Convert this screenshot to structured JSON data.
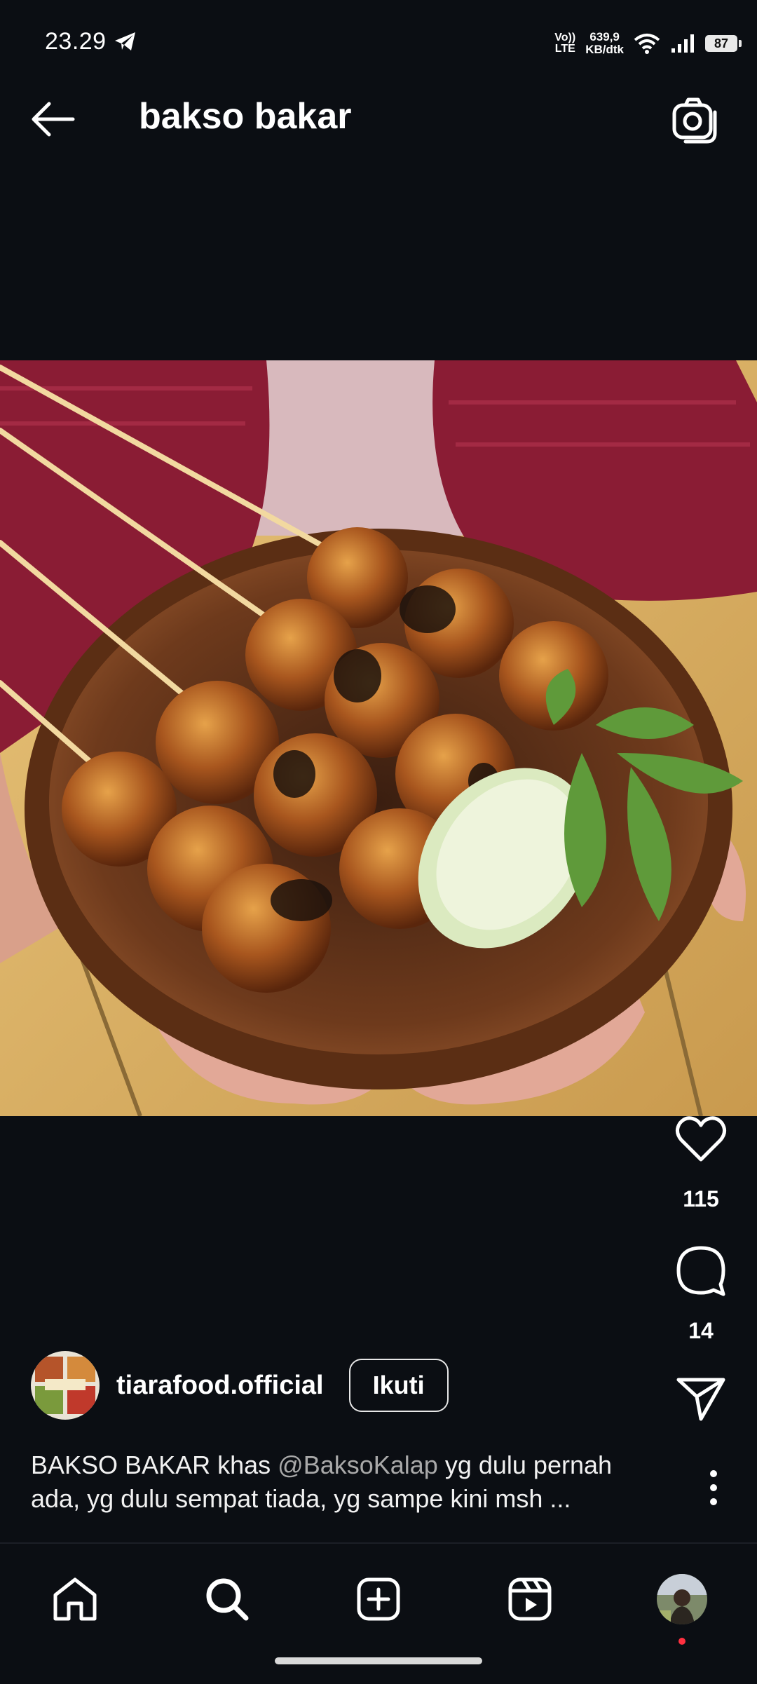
{
  "status_bar": {
    "time": "23.29",
    "volte": [
      "Vo))",
      "LTE"
    ],
    "net_speed": [
      "639,9",
      "KB/dtk"
    ],
    "battery": "87"
  },
  "header": {
    "title": "bakso bakar"
  },
  "post": {
    "likes": "115",
    "comments": "14",
    "username": "tiarafood.official",
    "follow_label": "Ikuti",
    "caption_start": "BAKSO BAKAR khas ",
    "caption_mention": "@BaksoKalap",
    "caption_rest": " yg dulu pernah ada, yg dulu sempat tiada, yg sampe kini msh ..."
  },
  "icons": {
    "back": "arrow-left-icon",
    "camera": "camera-icon",
    "like": "heart-icon",
    "comment": "comment-icon",
    "share": "send-icon",
    "more": "more-vertical-icon",
    "nav": [
      "home-icon",
      "search-icon",
      "create-icon",
      "reels-icon",
      "profile-avatar"
    ]
  },
  "colors": {
    "background": "#0b0e13",
    "notification_dot": "#ff3040"
  }
}
